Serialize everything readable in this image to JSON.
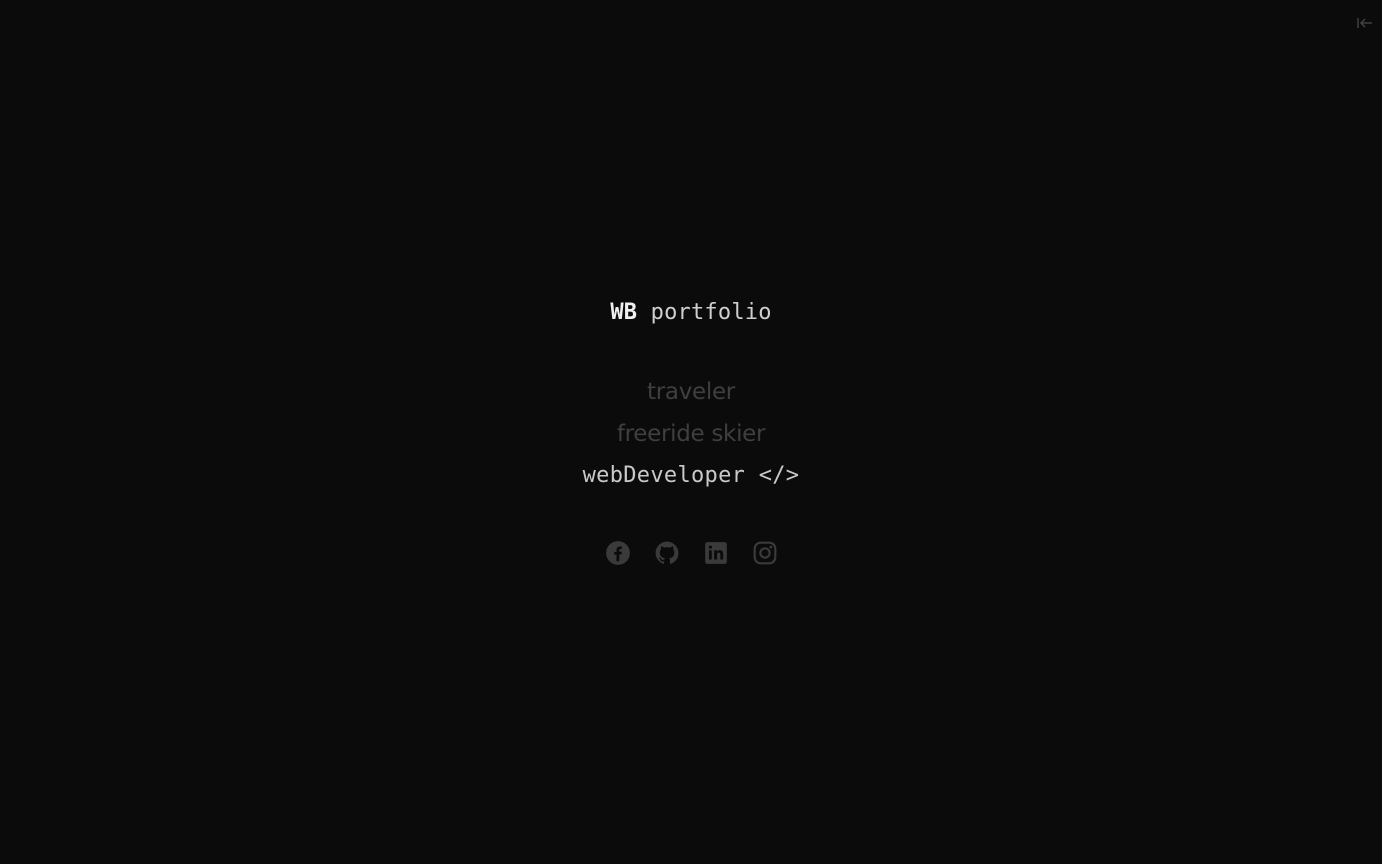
{
  "header": {
    "collapse_icon": "collapse-left-icon"
  },
  "brand": {
    "initials": "WB",
    "word": "portfolio"
  },
  "roles": {
    "items": [
      "traveler",
      "freeride skier",
      "webDeveloper </>"
    ],
    "active_index": 2
  },
  "socials": {
    "icons": [
      "facebook-icon",
      "github-icon",
      "linkedin-icon",
      "instagram-icon"
    ]
  },
  "colors": {
    "background": "#0b0b0b",
    "text_primary": "#efefef",
    "text_muted": "#3f3f3f",
    "icon_color": "#3a3a3a"
  }
}
